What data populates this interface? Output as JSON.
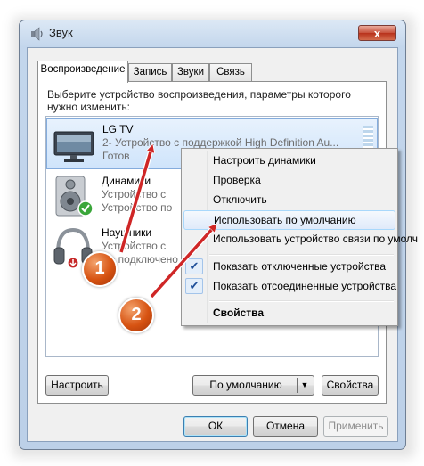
{
  "window": {
    "title": "Звук",
    "close_label": "x"
  },
  "tabs": [
    "Воспроизведение",
    "Запись",
    "Звуки",
    "Связь"
  ],
  "instruction": "Выберите устройство воспроизведения, параметры которого нужно изменить:",
  "devices": [
    {
      "name": "LG TV",
      "subtitle": "2- Устройство с поддержкой High Definition Au...",
      "status": "Готов",
      "icon": "tv-monitor-icon"
    },
    {
      "name": "Динамики",
      "subtitle": "Устройство с",
      "status": "Устройство по",
      "icon": "speaker-icon"
    },
    {
      "name": "Наушники",
      "subtitle": "Устройство с",
      "status": "Не подключено",
      "icon": "headphones-icon"
    }
  ],
  "buttons": {
    "configure": "Настроить",
    "default": "По умолчанию",
    "properties": "Свойства",
    "ok": "ОК",
    "cancel": "Отмена",
    "apply": "Применить"
  },
  "context_menu": {
    "items": [
      {
        "label": "Настроить динамики",
        "checked": false
      },
      {
        "label": "Проверка",
        "checked": false
      },
      {
        "label": "Отключить",
        "checked": false
      },
      {
        "label": "Использовать по умолчанию",
        "checked": false
      },
      {
        "label": "Использовать устройство связи по умолч",
        "checked": false
      },
      {
        "label": "Показать отключенные устройства",
        "checked": true
      },
      {
        "label": "Показать отсоединенные устройства",
        "checked": true
      },
      {
        "label": "Свойства",
        "checked": false
      }
    ]
  },
  "annotations": {
    "badge1": "1",
    "badge2": "2",
    "arrow_color": "#cf2626",
    "badge_color": "#d75312"
  }
}
